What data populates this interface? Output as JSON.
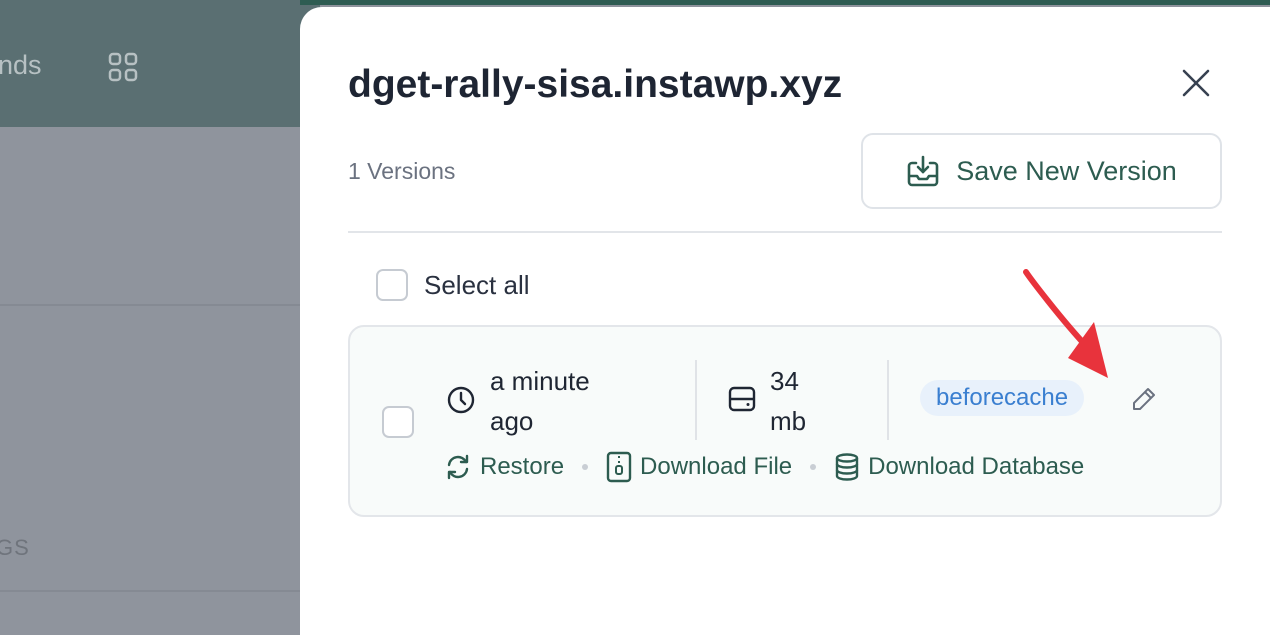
{
  "background": {
    "nav_partial": "nds",
    "section_partial": "GS"
  },
  "modal": {
    "title": "dget-rally-sisa.instawp.xyz",
    "versions_count": "1 Versions",
    "save_button_label": "Save New Version",
    "select_all_label": "Select all"
  },
  "versions": [
    {
      "time_line1": "a minute",
      "time_line2": "ago",
      "size_line1": "34",
      "size_line2": "mb",
      "tag": "beforecache",
      "actions": {
        "restore": "Restore",
        "download_file": "Download File",
        "download_database": "Download Database"
      }
    }
  ],
  "colors": {
    "accent": "#2d5c50",
    "tag_text": "#3a7fd0",
    "tag_bg": "#e8f1fb",
    "arrow": "#e8333c"
  }
}
